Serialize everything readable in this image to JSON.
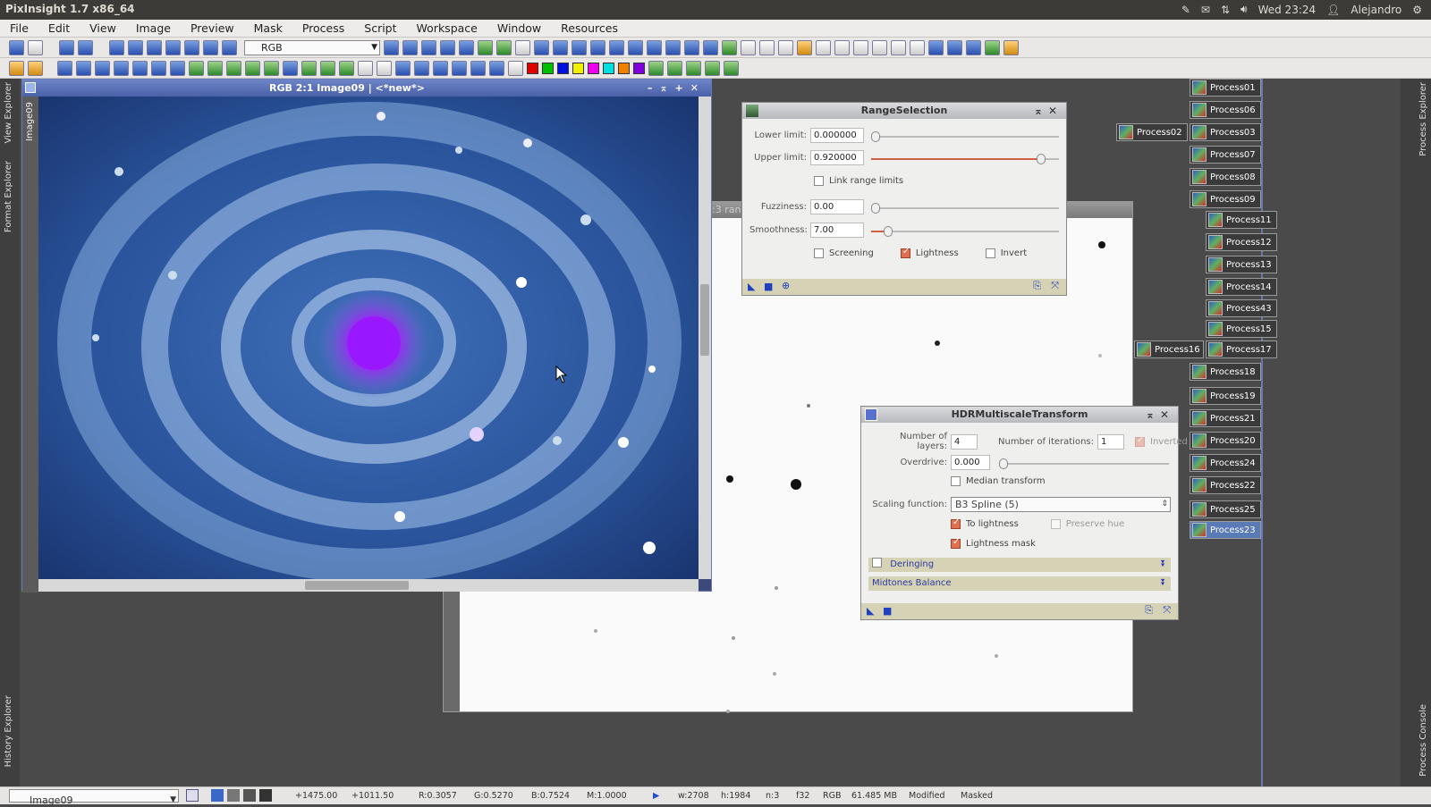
{
  "system": {
    "app_title": "PixInsight 1.7 x86_64",
    "clock": "Wed 23:24",
    "user": "Alejandro"
  },
  "menu": [
    "File",
    "Edit",
    "View",
    "Image",
    "Preview",
    "Mask",
    "Process",
    "Script",
    "Workspace",
    "Window",
    "Resources"
  ],
  "toolbar": {
    "channel_select": "RGB"
  },
  "left_tabs": {
    "view_explorer": "View Explorer",
    "format_explorer": "Format Explorer",
    "history_explorer": "History Explorer",
    "image_tab": "Image09"
  },
  "right_tabs": {
    "process_explorer": "Process Explorer",
    "process_console": "Process Console"
  },
  "image_window": {
    "title": "RGB 2:1 Image09 | <*new*>"
  },
  "bg_window": {
    "title": ":3 range"
  },
  "range_selection": {
    "title": "RangeSelection",
    "lower_label": "Lower limit:",
    "lower_value": "0.000000",
    "upper_label": "Upper limit:",
    "upper_value": "0.920000",
    "link_label": "Link range limits",
    "fuzziness_label": "Fuzziness:",
    "fuzziness_value": "0.00",
    "smoothness_label": "Smoothness:",
    "smoothness_value": "7.00",
    "screening_label": "Screening",
    "lightness_label": "Lightness",
    "invert_label": "Invert"
  },
  "hdr": {
    "title": "HDRMultiscaleTransform",
    "layers_label": "Number of layers:",
    "layers_value": "4",
    "iterations_label": "Number of iterations:",
    "iterations_value": "1",
    "inverted_label": "Inverted",
    "overdrive_label": "Overdrive:",
    "overdrive_value": "0.000",
    "median_label": "Median transform",
    "scaling_label": "Scaling function:",
    "scaling_value": "B3 Spline (5)",
    "to_lightness_label": "To lightness",
    "preserve_hue_label": "Preserve hue",
    "lightness_mask_label": "Lightness mask",
    "deringing_label": "Deringing",
    "midtones_label": "Midtones Balance"
  },
  "process_icons": [
    {
      "label": "Process01"
    },
    {
      "label": "Process06"
    },
    {
      "label": "Process02"
    },
    {
      "label": "Process03"
    },
    {
      "label": "Process07"
    },
    {
      "label": "Process08"
    },
    {
      "label": "Process09"
    },
    {
      "label": "Process11"
    },
    {
      "label": "Process12"
    },
    {
      "label": "Process13"
    },
    {
      "label": "Process14"
    },
    {
      "label": "Process43"
    },
    {
      "label": "Process15"
    },
    {
      "label": "Process16"
    },
    {
      "label": "Process17"
    },
    {
      "label": "Process18"
    },
    {
      "label": "Process19"
    },
    {
      "label": "Process21"
    },
    {
      "label": "Process20"
    },
    {
      "label": "Process24"
    },
    {
      "label": "Process22"
    },
    {
      "label": "Process25"
    },
    {
      "label": "Process23"
    }
  ],
  "status": {
    "view": "Image09",
    "x": "+1475.00",
    "y": "+1011.50",
    "r": "R:0.3057",
    "g": "G:0.5270",
    "b": "B:0.7524",
    "m": "M:1.0000",
    "w": "w:2708",
    "h": "h:1984",
    "n": "n:3",
    "f": "f32",
    "mode": "RGB",
    "size": "61.485 MB",
    "modified": "Modified",
    "masked": "Masked"
  }
}
